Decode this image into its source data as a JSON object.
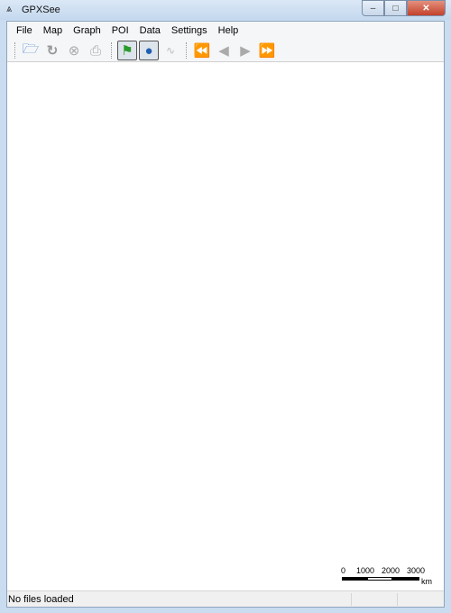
{
  "window": {
    "title": "GPXSee",
    "minimize_icon": "minimize-icon",
    "maximize_icon": "maximize-icon",
    "close_icon": "close-icon"
  },
  "menu": [
    "File",
    "Map",
    "Graph",
    "POI",
    "Data",
    "Settings",
    "Help"
  ],
  "toolbar": {
    "icons": [
      "open-file-icon",
      "reload-icon",
      "close-file-icon",
      "print-icon",
      "show-poi-icon",
      "show-map-icon",
      "show-graphs-icon",
      "first-icon",
      "previous-icon",
      "next-icon",
      "last-icon"
    ],
    "active": [
      "show-poi-icon",
      "show-map-icon"
    ]
  },
  "scale": {
    "labels": [
      "0",
      "1000",
      "2000",
      "3000"
    ],
    "unit": "km"
  },
  "status": {
    "text": "No files loaded"
  }
}
